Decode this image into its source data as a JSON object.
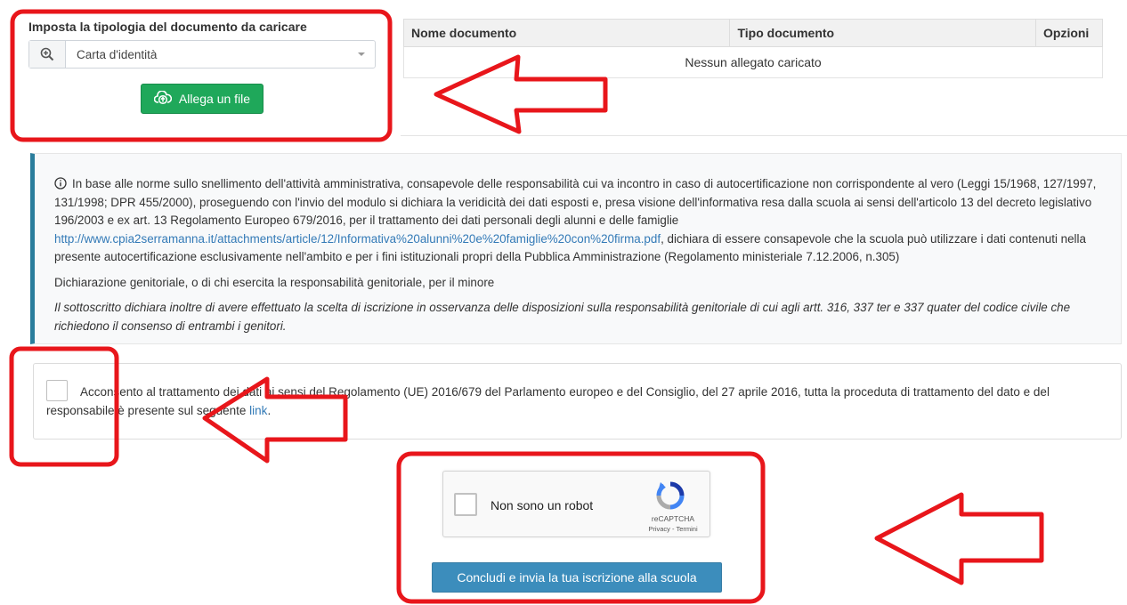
{
  "upload": {
    "title": "Imposta la tipologia del documento da caricare",
    "selected_type": "Carta d'identità",
    "attach_label": "Allega un file"
  },
  "documents_table": {
    "columns": [
      "Nome documento",
      "Tipo documento",
      "Opzioni"
    ],
    "empty_message": "Nessun allegato caricato"
  },
  "info": {
    "para1_text": "In base alle norme sullo snellimento dell'attività amministrativa, consapevole delle responsabilità cui va incontro in caso di autocertificazione non corrispondente al vero (Leggi 15/1968, 127/1997, 131/1998; DPR 455/2000), proseguendo con l'invio del modulo si dichiara la veridicità dei dati esposti e, presa visione dell'informativa resa dalla scuola ai sensi dell'articolo 13 del decreto legislativo 196/2003 e ex art. 13 Regolamento Europeo 679/2016, per il trattamento dei dati personali degli alunni e delle famiglie",
    "para1_link": "http://www.cpia2serramanna.it/attachments/article/12/Informativa%20alunni%20e%20famiglie%20con%20firma.pdf",
    "para1_end": ", dichiara di essere consapevole che la scuola può utilizzare i dati contenuti nella presente autocertificazione esclusivamente nell'ambito e per i fini istituzionali propri della Pubblica Amministrazione (Regolamento ministeriale 7.12.2006, n.305)",
    "para2": "Dichiarazione genitoriale, o di chi esercita la responsabilità genitoriale, per il minore",
    "para3": "Il sottoscritto dichiara inoltre di avere effettuato la scelta di iscrizione in osservanza delle disposizioni sulla responsabilità genitoriale di cui agli artt. 316, 337 ter e 337 quater del codice civile che richiedono il consenso di entrambi i genitori."
  },
  "consent": {
    "text": "Acconsento al trattamento dei dati ai sensi del Regolamento (UE) 2016/679 del Parlamento europeo e del Consiglio, del 27 aprile 2016, tutta la proceduta di trattamento del dato e del responsabile è presente sul seguente",
    "link_label": "link",
    "suffix": "."
  },
  "captcha": {
    "label": "Non sono un robot",
    "brand": "reCAPTCHA",
    "privacy": "Privacy",
    "separator": " - ",
    "terms": "Termini"
  },
  "submit_label": "Concludi e invia la tua iscrizione alla scuola",
  "icons": {
    "select": "zoom-in-icon",
    "attach": "cloud-upload-icon",
    "info": "info-circle-icon",
    "captcha": "recaptcha-logo-icon"
  },
  "colors": {
    "attach_button": "#1fa85a",
    "submit_button": "#3c8dbc",
    "link": "#337ab7",
    "info_accent": "#2a7d9c",
    "annotation": "#e8161b"
  }
}
